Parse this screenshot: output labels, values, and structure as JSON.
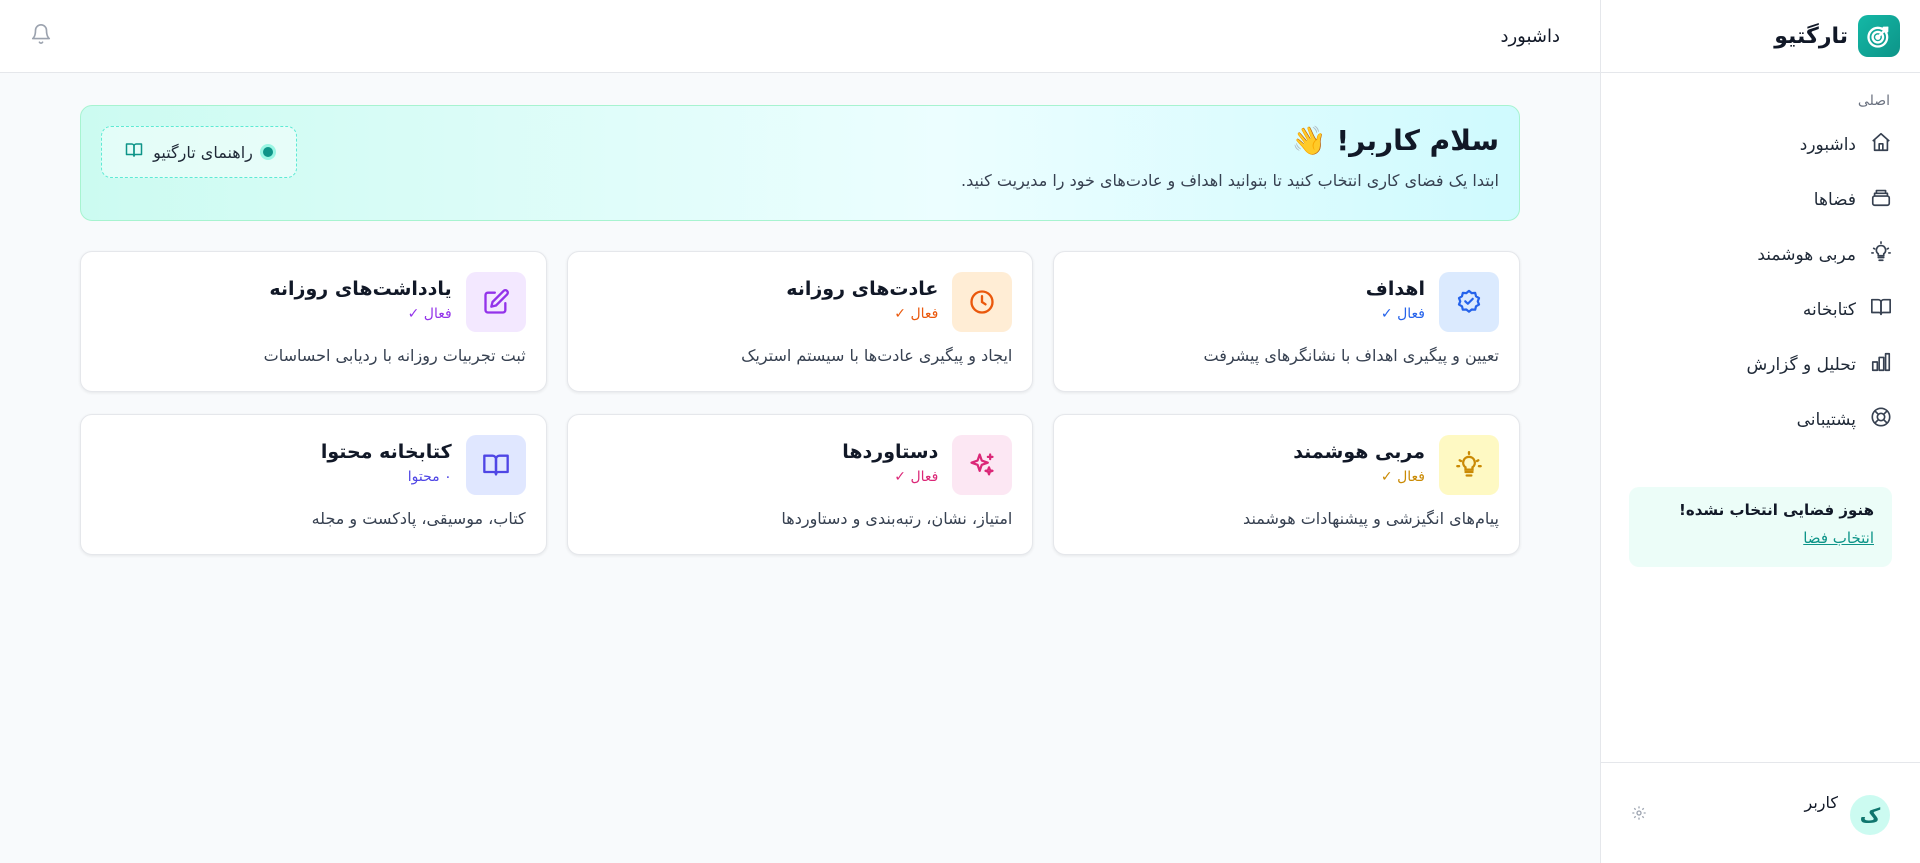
{
  "brand": {
    "name": "تارگتیو"
  },
  "sidebar": {
    "section_label": "اصلی",
    "items": [
      {
        "label": "داشبورد",
        "icon": "home-icon"
      },
      {
        "label": "فضاها",
        "icon": "stack-icon"
      },
      {
        "label": "مربی هوشمند",
        "icon": "lightbulb-icon"
      },
      {
        "label": "کتابخانه",
        "icon": "book-icon"
      },
      {
        "label": "تحلیل و گزارش",
        "icon": "chart-icon"
      },
      {
        "label": "پشتیبانی",
        "icon": "lifebuoy-icon"
      }
    ],
    "no_space": {
      "title": "هنوز فضایی انتخاب نشده!",
      "link": "انتخاب فضا"
    },
    "user": {
      "initial": "ک",
      "name": "کاربر"
    }
  },
  "header": {
    "title": "داشبورد"
  },
  "hero": {
    "title": "سلام کاربر!",
    "emoji": "👋",
    "subtitle": "ابتدا یک فضای کاری انتخاب کنید تا بتوانید اهداف و عادت‌های خود را مدیریت کنید.",
    "guide_label": "راهنمای تارگتیو"
  },
  "cards": [
    {
      "title": "اهداف",
      "status": "فعال ✓",
      "desc": "تعیین و پیگیری اهداف با نشانگرهای پیشرفت",
      "color": "#2563eb",
      "bg": "#dbeafe",
      "icon": "badge-check-icon"
    },
    {
      "title": "عادت‌های روزانه",
      "status": "فعال ✓",
      "desc": "ایجاد و پیگیری عادت‌ها با سیستم استریک",
      "color": "#ea580c",
      "bg": "#ffedd5",
      "icon": "clock-icon"
    },
    {
      "title": "یادداشت‌های روزانه",
      "status": "فعال ✓",
      "desc": "ثبت تجربیات روزانه با ردیابی احساسات",
      "color": "#9333ea",
      "bg": "#f3e8ff",
      "icon": "edit-icon"
    },
    {
      "title": "مربی هوشمند",
      "status": "فعال ✓",
      "desc": "پیام‌های انگیزشی و پیشنهادات هوشمند",
      "color": "#ca8a04",
      "bg": "#fef9c3",
      "icon": "lightbulb-icon"
    },
    {
      "title": "دستاوردها",
      "status": "فعال ✓",
      "desc": "امتیاز، نشان، رتبه‌بندی و دستاوردها",
      "color": "#db2777",
      "bg": "#fce7f3",
      "icon": "sparkles-icon"
    },
    {
      "title": "کتابخانه محتوا",
      "status": "۰ محتوا",
      "desc": "کتاب، موسیقی، پادکست و مجله",
      "color": "#4f46e5",
      "bg": "#e0e7ff",
      "icon": "book-open-icon"
    }
  ]
}
